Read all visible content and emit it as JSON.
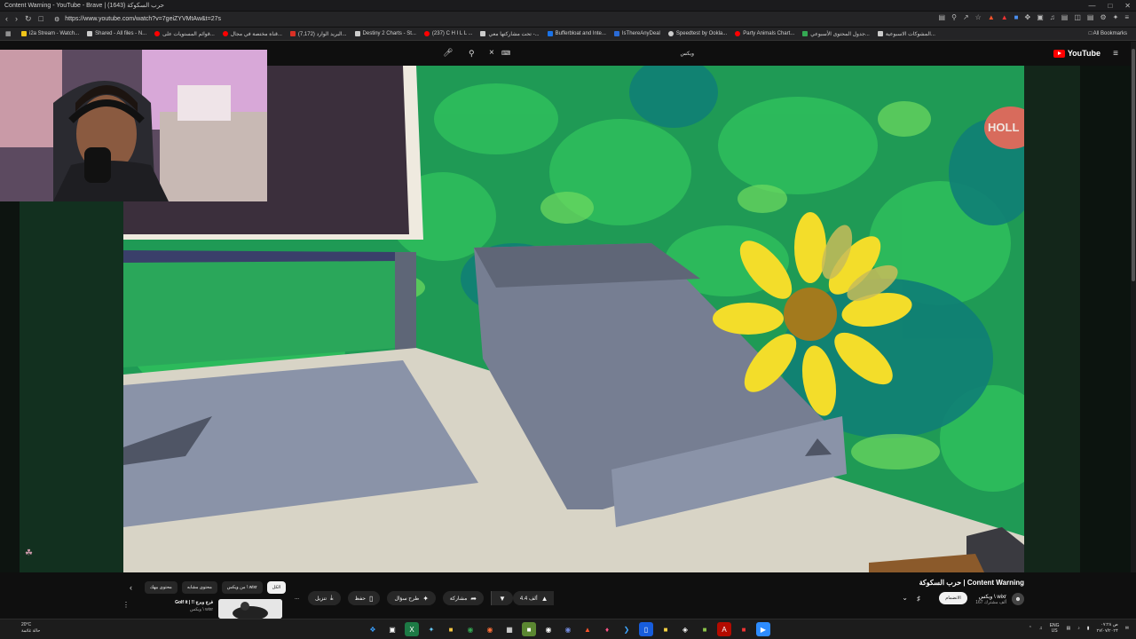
{
  "browser": {
    "window_title": "Content Warning - YouTube - Brave | حرب السكوكة (1643)",
    "url": "https://www.youtube.com/watch?v=7geiZYVMtAw&t=27s",
    "bookmarks": [
      {
        "label": "i2a Stream - Watch...",
        "color": "#f0c419"
      },
      {
        "label": "Shared - All files - N...",
        "color": "#cccccc"
      },
      {
        "label": "قوائم المستويات على...",
        "color": "#ff0000"
      },
      {
        "label": "قناة مختصة في مجال...",
        "color": "#ff0000"
      },
      {
        "label": "(7,172) البريد الوارد...",
        "color": "#d93025"
      },
      {
        "label": "Destiny 2 Charts - St...",
        "color": "#cccccc"
      },
      {
        "label": "(237) C H I L L ...",
        "color": "#ff0000"
      },
      {
        "label": "تحت مشاركتها معي -...",
        "color": "#cccccc"
      },
      {
        "label": "Bufferbloat and Inte...",
        "color": "#1a73e8"
      },
      {
        "label": "IsThereAnyDeal",
        "color": "#2a6bd6"
      },
      {
        "label": "Speedtest by Ookla...",
        "color": "#cccccc"
      },
      {
        "label": "Party Animals Chart...",
        "color": "#ff0000"
      },
      {
        "label": "جدول المحتوى الأسبوعي...",
        "color": "#34a853"
      },
      {
        "label": "المشوكات الاسبوعية...",
        "color": "#cccccc"
      }
    ],
    "all_bookmarks": "All Bookmarks"
  },
  "youtube": {
    "logo_text": "YouTube",
    "search_query": "ويكس",
    "video_watermark": "HOLL",
    "video_title": "حرب السكوكة | Content Warning",
    "channel_name": "ويكس \\ wixr",
    "channel_subs": "167 ألف مشترك",
    "join_label": "الانضمام",
    "actions": {
      "likes": "4.4 ألف",
      "share": "مشاركة",
      "ask": "طرح سؤال",
      "save": "حفظ",
      "download": "تنزيل",
      "more": "..."
    },
    "chips": [
      "الكل",
      "من ويكس \\ wixr",
      "محتوى مشابه",
      "محتوى بيهك"
    ],
    "recommendation": {
      "title": "Golf it | !! فرج وبرج",
      "meta": "ويكس \\ wixr"
    }
  },
  "taskbar": {
    "temp": "20°C",
    "weather": "حالة غائمة",
    "lang_top": "ENG",
    "lang_bottom": "US",
    "time": "۰۷:۲۸ ص",
    "date": "۲۷/۰۷/۲۰۲۴"
  }
}
